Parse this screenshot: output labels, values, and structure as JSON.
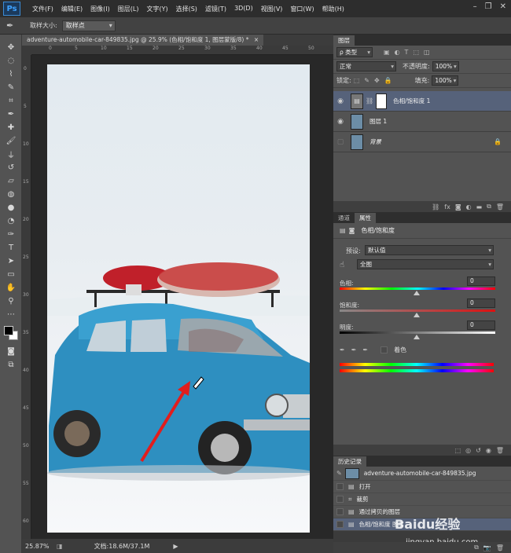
{
  "app": {
    "logo": "Ps"
  },
  "menu": {
    "items": [
      "文件(F)",
      "编辑(E)",
      "图像(I)",
      "图层(L)",
      "文字(Y)",
      "选择(S)",
      "滤镜(T)",
      "3D(D)",
      "视图(V)",
      "窗口(W)",
      "帮助(H)"
    ]
  },
  "window_controls": {
    "minimize": "–",
    "restore": "❐",
    "close": "✕"
  },
  "options": {
    "sample_size_label": "取样大小:",
    "sample_size_value": "取样点"
  },
  "document": {
    "tab_title": "adventure-automobile-car-849835.jpg @ 25.9% (色相/饱和度 1, 图层蒙版/8) *",
    "tab_close": "×",
    "ruler_h": [
      "0",
      "5",
      "10",
      "15",
      "20",
      "25",
      "30",
      "35",
      "40",
      "45",
      "50"
    ],
    "ruler_v": [
      "0",
      "5",
      "10",
      "15",
      "20",
      "25",
      "30",
      "35",
      "40",
      "45",
      "50",
      "55",
      "60"
    ]
  },
  "status": {
    "zoom": "25.87%",
    "doc_size": "文档:18.6M/37.1M"
  },
  "layers_panel": {
    "tab": "图层",
    "filter_label": "ρ 类型",
    "blend_mode": "正常",
    "opacity_label": "不透明度:",
    "opacity_value": "100%",
    "lock_label": "锁定:",
    "fill_label": "填充:",
    "fill_value": "100%",
    "layers": [
      {
        "name": "色相/饱和度 1",
        "selected": true
      },
      {
        "name": "图层 1",
        "selected": false
      },
      {
        "name": "背景",
        "selected": false
      }
    ],
    "footer_icons": [
      "link-icon",
      "fx-icon",
      "mask-icon",
      "adjustment-icon",
      "folder-icon",
      "new-layer-icon",
      "trash-icon"
    ]
  },
  "properties_panel": {
    "tabs": [
      "通道",
      "属性"
    ],
    "title": "色相/饱和度",
    "preset_label": "预设:",
    "preset_value": "默认值",
    "channel_value": "全图",
    "hue_label": "色相:",
    "hue_value": "0",
    "saturation_label": "饱和度:",
    "saturation_value": "0",
    "lightness_label": "明度:",
    "lightness_value": "0",
    "colorize_label": "着色"
  },
  "history_panel": {
    "tab": "历史记录",
    "snapshot": "adventure-automobile-car-849835.jpg",
    "steps": [
      "打开",
      "裁剪",
      "通过拷贝的图层",
      "色相/饱和度 图层"
    ]
  },
  "watermark": {
    "text": "Baidu经验",
    "url": "jingyan.baidu.com"
  },
  "colors": {
    "accent_selected_layer": "#56627a",
    "car_blue": "#2e8fc0",
    "arrow_red": "#e21d1d"
  }
}
